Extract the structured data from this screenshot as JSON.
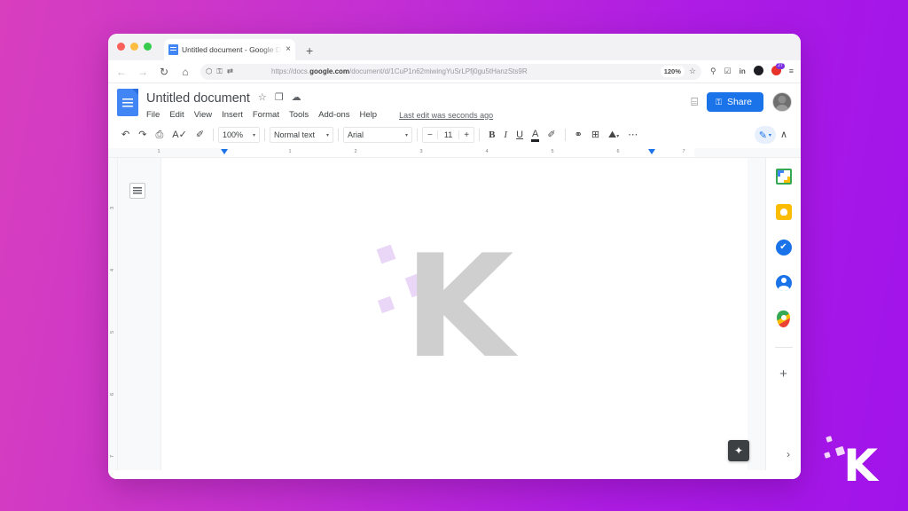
{
  "browser": {
    "traffic_lights": [
      "close",
      "minimize",
      "maximize"
    ],
    "tab": {
      "title": "Untitled document - Google Do",
      "favicon": "google-docs-favicon",
      "close_label": "×"
    },
    "new_tab_label": "+",
    "nav": {
      "back": "←",
      "forward": "→",
      "reload": "↻",
      "home": "⌂"
    },
    "omnibox": {
      "shield_icon": "⬡",
      "lock_icon": "⚿",
      "sync_icon": "⇄",
      "url_prefix": "https://docs.",
      "url_domain": "google.com",
      "url_path": "/document/d/1CuP1n62miwingYuSrLPfj0gu5tHanzSts9R",
      "zoom_badge": "120%",
      "bookmark_icon": "☆"
    },
    "extensions": [
      {
        "name": "save-to-pocket-icon",
        "glyph": "⚲"
      },
      {
        "name": "shield-extension-icon",
        "glyph": "☑"
      },
      {
        "name": "linkedin-extension-icon",
        "glyph": "in"
      },
      {
        "name": "dark-circle-extension-icon",
        "glyph": ""
      },
      {
        "name": "red-extension-icon",
        "glyph": "",
        "badge": "27"
      }
    ],
    "menu_icon": "≡"
  },
  "docs": {
    "logo_icon": "google-docs-logo",
    "document_title": "Untitled document",
    "title_icons": [
      {
        "name": "star-icon",
        "glyph": "☆"
      },
      {
        "name": "move-to-folder-icon",
        "glyph": "❐"
      },
      {
        "name": "cloud-saved-icon",
        "glyph": "☁"
      }
    ],
    "menu": [
      "File",
      "Edit",
      "View",
      "Insert",
      "Format",
      "Tools",
      "Add-ons",
      "Help"
    ],
    "last_edit": "Last edit was seconds ago",
    "comment_icon": "⌸",
    "share": {
      "label": "Share",
      "lock_icon": "⚿",
      "color": "#1a73e8"
    },
    "avatar": "user-avatar",
    "toolbar": {
      "undo": "↶",
      "redo": "↷",
      "print": "⎙",
      "spellcheck": "A✓",
      "paint_format": "✐",
      "zoom_value": "100%",
      "paragraph_style": "Normal text",
      "font_family": "Arial",
      "font_size_minus": "−",
      "font_size": "11",
      "font_size_plus": "+",
      "bold": "B",
      "italic": "I",
      "underline": "U",
      "text_color": "A",
      "highlight": "✐",
      "link": "⚭",
      "comment": "⊞",
      "image": "⛰",
      "more": "⋯",
      "editing_mode": "✎",
      "collapse": "∧",
      "caret": "▾"
    },
    "ruler": {
      "horizontal_numbers": [
        "1",
        "1",
        "2",
        "3",
        "4",
        "5",
        "6",
        "7"
      ],
      "vertical_numbers": [
        "3",
        "4",
        "5",
        "6",
        "7"
      ],
      "left_indent_marker": "left-indent",
      "right_indent_marker": "right-indent"
    },
    "outline_button": "document-outline",
    "page_watermark": {
      "letter": "K",
      "letter_color": "#cfcfcf",
      "square_color": "#ead6f7"
    },
    "sidebar": [
      {
        "name": "google-calendar-icon",
        "label": "Calendar"
      },
      {
        "name": "google-keep-icon",
        "label": "Keep"
      },
      {
        "name": "google-tasks-icon",
        "label": "Tasks",
        "glyph": "✔"
      },
      {
        "name": "google-contacts-icon",
        "label": "Contacts"
      },
      {
        "name": "google-maps-icon",
        "label": "Maps"
      },
      {
        "name": "add-ons-plus-icon",
        "label": "Get add-ons",
        "glyph": "+"
      }
    ],
    "explore_button": {
      "name": "explore-icon",
      "glyph": "✦"
    },
    "expand_button": {
      "name": "chevron-right-icon",
      "glyph": "›"
    }
  },
  "branding": {
    "watermark_letter": "K",
    "background_start": "#d83fbe",
    "background_end": "#a013ea"
  }
}
